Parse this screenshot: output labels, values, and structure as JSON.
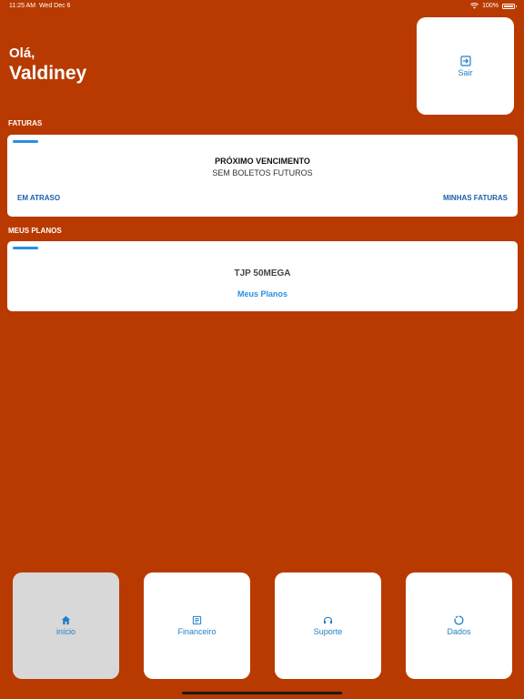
{
  "status_bar": {
    "time": "11:25 AM",
    "date": "Wed Dec 6",
    "battery": "100%"
  },
  "greeting": {
    "hello": "Olá,",
    "name": "Valdiney"
  },
  "logout": {
    "label": "Sair",
    "icon": "logout-icon"
  },
  "invoices": {
    "section_label": "FATURAS",
    "next_due_label": "PRÓXIMO VENCIMENTO",
    "next_due_value": "SEM BOLETOS FUTUROS",
    "overdue_link": "EM ATRASO",
    "my_invoices_link": "MINHAS FATURAS"
  },
  "plans": {
    "section_label": "MEUS PLANOS",
    "plan_name": "TJP 50MEGA",
    "link": "Meus Planos"
  },
  "tabs": [
    {
      "label": "início",
      "icon": "home-icon",
      "active": true
    },
    {
      "label": "Financeiro",
      "icon": "document-icon",
      "active": false
    },
    {
      "label": "Suporte",
      "icon": "support-icon",
      "active": false
    },
    {
      "label": "Dados",
      "icon": "data-usage-icon",
      "active": false
    }
  ],
  "colors": {
    "background": "#B83A00",
    "accent_blue": "#2B8FE0",
    "card": "#FFFFFF"
  }
}
